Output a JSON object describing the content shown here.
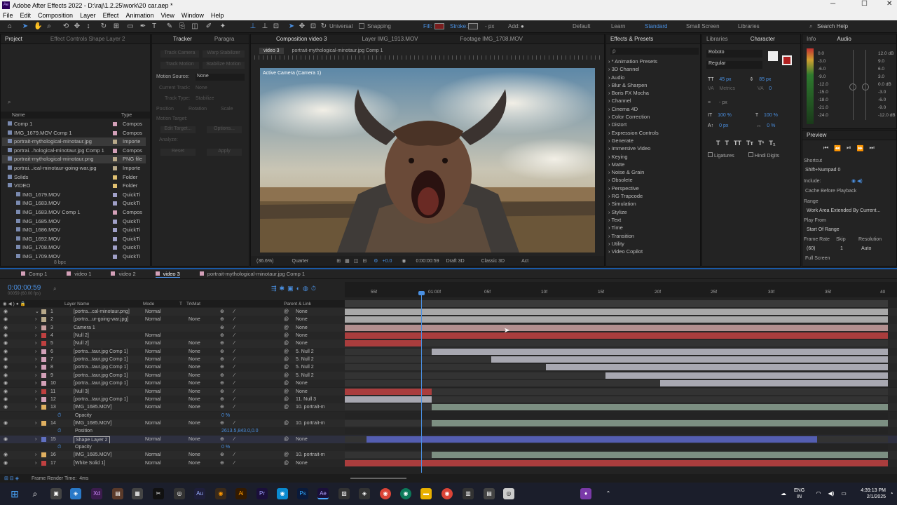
{
  "window": {
    "title": "Adobe After Effects 2022 - D:\\raj\\1.2.25\\work\\20 car.aep *",
    "min": "─",
    "max": "☐",
    "close": "✕"
  },
  "menu": [
    "File",
    "Edit",
    "Composition",
    "Layer",
    "Effect",
    "Animation",
    "View",
    "Window",
    "Help"
  ],
  "toolbar": {
    "universal": "Universal",
    "snapping": "Snapping",
    "fill": "Fill:",
    "stroke": "Stroke:",
    "px": "- px",
    "add": "Add:",
    "workspaces": [
      "Default",
      "Learn",
      "Standard",
      "Small Screen",
      "Libraries"
    ],
    "search_placeholder": "Search Help"
  },
  "project": {
    "tab": "Project",
    "effect_controls_tab": "Effect Controls Shape Layer 2",
    "col_name": "Name",
    "col_type": "Type",
    "items": [
      {
        "name": "Comp 1",
        "type": "Compos",
        "color": "#d3a0b8",
        "icon": "comp-icon"
      },
      {
        "name": "IMG_1679.MOV Comp 1",
        "type": "Compos",
        "color": "#d3a0b8",
        "icon": "comp-icon"
      },
      {
        "name": "portrait-mythological-minotaur.jpg",
        "type": "Importe",
        "color": "#b8a98a",
        "icon": "image-icon"
      },
      {
        "name": "portrai...hological-minotaur.jpg Comp 1",
        "type": "Compos",
        "color": "#d3a0b8",
        "icon": "comp-icon"
      },
      {
        "name": "portrait-mythological-minotaur.png",
        "type": "PNG file",
        "color": "#b8a98a",
        "icon": "image-icon"
      },
      {
        "name": "portrai...ical-minotaur-going-war.jpg",
        "type": "Importe",
        "color": "#b8a98a",
        "icon": "image-icon"
      },
      {
        "name": "Solids",
        "type": "Folder",
        "color": "#e0c070",
        "icon": "folder-icon"
      },
      {
        "name": "VIDEO",
        "type": "Folder",
        "color": "#e0c070",
        "icon": "folder-icon"
      },
      {
        "name": "IMG_1679.MOV",
        "type": "QuickTi",
        "color": "#a0a0c8",
        "icon": "video-icon"
      },
      {
        "name": "IMG_1683.MOV",
        "type": "QuickTi",
        "color": "#a0a0c8",
        "icon": "video-icon"
      },
      {
        "name": "IMG_1683.MOV Comp 1",
        "type": "Compos",
        "color": "#d3a0b8",
        "icon": "comp-icon"
      },
      {
        "name": "IMG_1685.MOV",
        "type": "QuickTi",
        "color": "#a0a0c8",
        "icon": "video-icon"
      },
      {
        "name": "IMG_1686.MOV",
        "type": "QuickTi",
        "color": "#a0a0c8",
        "icon": "video-icon"
      },
      {
        "name": "IMG_1692.MOV",
        "type": "QuickTi",
        "color": "#a0a0c8",
        "icon": "video-icon"
      },
      {
        "name": "IMG_1708.MOV",
        "type": "QuickTi",
        "color": "#a0a0c8",
        "icon": "video-icon"
      },
      {
        "name": "IMG_1709.MOV",
        "type": "QuickTi",
        "color": "#a0a0c8",
        "icon": "video-icon"
      }
    ],
    "bpc": "8 bpc"
  },
  "tracker": {
    "tab": "Tracker",
    "paragraph_tab": "Paragra",
    "motion_source_label": "Motion Source:",
    "motion_source": "None",
    "buttons": [
      "Track Camera",
      "Warp Stabilizer",
      "Track Motion",
      "Stabilize Motion"
    ],
    "current_track": "Current Track:",
    "track_type": "Track Type:",
    "current_track_val": "None",
    "track_type_val": "Stabilize",
    "checks": [
      "Position",
      "Rotation",
      "Scale"
    ],
    "motion_target": "Motion Target:",
    "edit_target": "Edit Target...",
    "options": "Options...",
    "analyze": "Analyze:",
    "reset": "Reset",
    "apply": "Apply"
  },
  "composition": {
    "tab": "Composition video 3",
    "layer_tab": "Layer IMG_1913.MOV",
    "footage_tab": "Footage IMG_1708.MOV",
    "sub_tabs": [
      "video 3",
      "portrait-mythological-minotaur.jpg Comp 1"
    ],
    "viewer_label": "Active Camera (Camera 1)",
    "zoom": "(36.6%)",
    "resolution": "Quarter",
    "exposure": "+0.0",
    "timecode": "0:00:00:59",
    "draft": "Draft 3D",
    "renderer": "Classic 3D",
    "act": "Act"
  },
  "effects": {
    "tab": "Effects & Presets",
    "search_placeholder": "ρ",
    "items": [
      "* Animation Presets",
      "3D Channel",
      "Audio",
      "Blur & Sharpen",
      "Boris FX Mocha",
      "Channel",
      "Cinema 4D",
      "Color Correction",
      "Distort",
      "Expression Controls",
      "Generate",
      "Immersive Video",
      "Keying",
      "Matte",
      "Noise & Grain",
      "Obsolete",
      "Perspective",
      "RG Trapcode",
      "Simulation",
      "Stylize",
      "Text",
      "Time",
      "Transition",
      "Utility",
      "Video Copilot"
    ]
  },
  "character": {
    "libraries_tab": "Libraries",
    "tab": "Character",
    "font": "Roboto",
    "style": "Regular",
    "size": "45 px",
    "leading": "85 px",
    "tracking": "0",
    "kerning": "Metrics",
    "stroke_px": "- px",
    "vscale": "100 %",
    "hscale": "100 %",
    "baseline": "0 px",
    "tsume": "0 %",
    "ligatures": "Ligatures",
    "hindi": "Hindi Digits",
    "tt_buttons": [
      "T",
      "T",
      "TT",
      "Tт",
      "T¹",
      "T₁"
    ]
  },
  "info": {
    "tab": "Info",
    "audio_tab": "Audio",
    "left_scale": [
      "0.0",
      "-3.0",
      "-6.0",
      "-9.0",
      "-12.0",
      "-15.0",
      "-18.0",
      "-21.0",
      "-24.0"
    ],
    "right_scale": [
      "12.0 dB",
      "9.0",
      "6.0",
      "3.0",
      "0.0 dB",
      "-3.0",
      "-6.0",
      "-9.0",
      "-12.0 dB"
    ]
  },
  "preview": {
    "tab": "Preview",
    "shortcut_label": "Shortcut",
    "shortcut": "Shift+Numpad 0",
    "include": "Include:",
    "cache": "Cache Before Playback",
    "range_label": "Range",
    "range": "Work Area Extended By Current...",
    "play_from_label": "Play From",
    "play_from": "Start Of Range",
    "frame_rate_label": "Frame Rate",
    "skip_label": "Skip",
    "resolution_label": "Resolution",
    "frame_rate": "(60)",
    "skip": "1",
    "resolution": "Auto",
    "full_screen": "Full Screen"
  },
  "timeline": {
    "tabs": [
      "Comp 1",
      "video 1",
      "video 2",
      "video 3",
      "portrait-mythological-minotaur.jpg Comp 1"
    ],
    "active_tab": 3,
    "timecode": "0:00:00:59",
    "fps": "00059 (60.00 fps)",
    "headers": {
      "layer_name": "Layer Name",
      "mode": "Mode",
      "t": "T",
      "trkmat": "TrkMat",
      "parent": "Parent & Link"
    },
    "ruler": [
      "55f",
      "01:00f",
      "05f",
      "10f",
      "15f",
      "20f",
      "25f",
      "30f",
      "35f",
      "40"
    ],
    "rows": [
      {
        "num": "1",
        "name": "[portra...cal-minotaur.png]",
        "mode": "Normal",
        "trk": "",
        "parent": "None",
        "color": "#b8a98a",
        "bar": "#bdbdbd",
        "bs": 0,
        "be": 1,
        "expand": true
      },
      {
        "num": "2",
        "name": "[portra...ur-going-war.jpg]",
        "mode": "Normal",
        "trk": "None",
        "parent": "None",
        "color": "#b8a98a",
        "bar": "#bdbdbd",
        "bs": 0,
        "be": 1
      },
      {
        "num": "3",
        "name": "Camera 1",
        "mode": "",
        "trk": "",
        "parent": "None",
        "color": "#c9a0a0",
        "bar": "#c9a0a0",
        "bs": 0,
        "be": 1
      },
      {
        "num": "4",
        "name": "[Null 2]",
        "mode": "Normal",
        "trk": "",
        "parent": "None",
        "color": "#c04040",
        "bar": "#c04040",
        "bs": 0,
        "be": 1
      },
      {
        "num": "5",
        "name": "[Null 2]",
        "mode": "Normal",
        "trk": "None",
        "parent": "None",
        "color": "#c04040",
        "bar": "#c04040",
        "bs": 0,
        "be": 0.14
      },
      {
        "num": "6",
        "name": "[portra...taur.jpg Comp 1]",
        "mode": "Normal",
        "trk": "None",
        "parent": "5. Null 2",
        "color": "#d3a0b8",
        "bar": "#bdbdc8",
        "bs": 0.16,
        "be": 1
      },
      {
        "num": "7",
        "name": "[portra...taur.jpg Comp 1]",
        "mode": "Normal",
        "trk": "None",
        "parent": "5. Null 2",
        "color": "#d3a0b8",
        "bar": "#bdbdc8",
        "bs": 0.27,
        "be": 1
      },
      {
        "num": "8",
        "name": "[portra...taur.jpg Comp 1]",
        "mode": "Normal",
        "trk": "None",
        "parent": "5. Null 2",
        "color": "#d3a0b8",
        "bar": "#bdbdc8",
        "bs": 0.37,
        "be": 1
      },
      {
        "num": "9",
        "name": "[portra...taur.jpg Comp 1]",
        "mode": "Normal",
        "trk": "None",
        "parent": "5. Null 2",
        "color": "#d3a0b8",
        "bar": "#bdbdc8",
        "bs": 0.48,
        "be": 1
      },
      {
        "num": "10",
        "name": "[portra...taur.jpg Comp 1]",
        "mode": "Normal",
        "trk": "None",
        "parent": "None",
        "color": "#d3a0b8",
        "bar": "#bdbdc8",
        "bs": 0.58,
        "be": 1
      },
      {
        "num": "11",
        "name": "[Null 3]",
        "mode": "Normal",
        "trk": "None",
        "parent": "None",
        "color": "#c04040",
        "bar": "#c04040",
        "bs": 0,
        "be": 0.16
      },
      {
        "num": "12",
        "name": "[portra...taur.jpg Comp 1]",
        "mode": "Normal",
        "trk": "None",
        "parent": "11. Null 3",
        "color": "#d3a0b8",
        "bar": "#bdbdc8",
        "bs": 0,
        "be": 0.16
      },
      {
        "num": "13",
        "name": "[IMG_1685.MOV]",
        "mode": "Normal",
        "trk": "None",
        "parent": "10. portrait-m",
        "color": "#e0b060",
        "bar": "#8aa090",
        "bs": 0.16,
        "be": 1
      },
      {
        "prop": "Opacity",
        "val": "0 %"
      },
      {
        "num": "14",
        "name": "[IMG_1685.MOV]",
        "mode": "Normal",
        "trk": "None",
        "parent": "10. portrait-m",
        "color": "#e0b060",
        "bar": "#8aa090",
        "bs": 0.16,
        "be": 1
      },
      {
        "prop": "Position",
        "val": "2613.5,843.0,0.0"
      },
      {
        "num": "15",
        "name": "Shape Layer 2",
        "mode": "Normal",
        "trk": "None",
        "parent": "None",
        "color": "#6070c0",
        "bar": "#5a66c8",
        "bs": 0.04,
        "be": 0.87,
        "selected": true
      },
      {
        "prop": "Opacity",
        "val": "0 %"
      },
      {
        "num": "16",
        "name": "[IMG_1685.MOV]",
        "mode": "Normal",
        "trk": "None",
        "parent": "10. portrait-m",
        "color": "#e0b060",
        "bar": "#8aa090",
        "bs": 0.16,
        "be": 1
      },
      {
        "num": "17",
        "name": "[White Solid 1]",
        "mode": "Normal",
        "trk": "None",
        "parent": "None",
        "color": "#c04040",
        "bar": "#c04040",
        "bs": 0,
        "be": 1
      }
    ],
    "render_time_label": "Frame Render Time:",
    "render_time": "4ms"
  },
  "taskbar": {
    "lang": "ENG",
    "region": "IN",
    "time": "4:39:13 PM",
    "date": "2/1/2025"
  }
}
